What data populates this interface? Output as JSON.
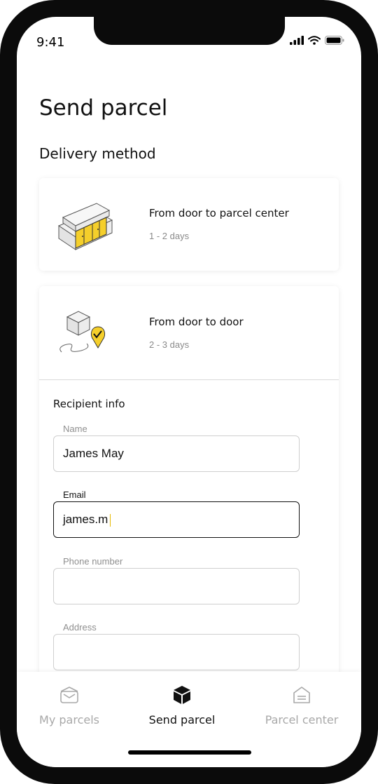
{
  "status_bar": {
    "time": "9:41"
  },
  "header": {
    "title": "Send parcel"
  },
  "delivery": {
    "section_title": "Delivery method",
    "options": [
      {
        "title": "From door to parcel center",
        "duration": "1 - 2 days",
        "icon": "parcel-locker-icon"
      },
      {
        "title": "From door to door",
        "duration": "2 - 3 days",
        "icon": "door-delivery-icon"
      }
    ]
  },
  "recipient": {
    "section_title": "Recipient info",
    "fields": {
      "name": {
        "label": "Name",
        "value": "James May"
      },
      "email": {
        "label": "Email",
        "value": "james.m"
      },
      "phone": {
        "label": "Phone number",
        "value": ""
      },
      "address": {
        "label": "Address",
        "value": ""
      }
    }
  },
  "tabbar": {
    "tabs": [
      {
        "label": "My parcels",
        "icon": "envelope-box-icon",
        "active": false
      },
      {
        "label": "Send parcel",
        "icon": "cube-icon",
        "active": true
      },
      {
        "label": "Parcel center",
        "icon": "parcel-center-icon",
        "active": false
      }
    ]
  },
  "colors": {
    "accent": "#F5CF2B",
    "text": "#111111",
    "muted": "#8A8A8A"
  }
}
